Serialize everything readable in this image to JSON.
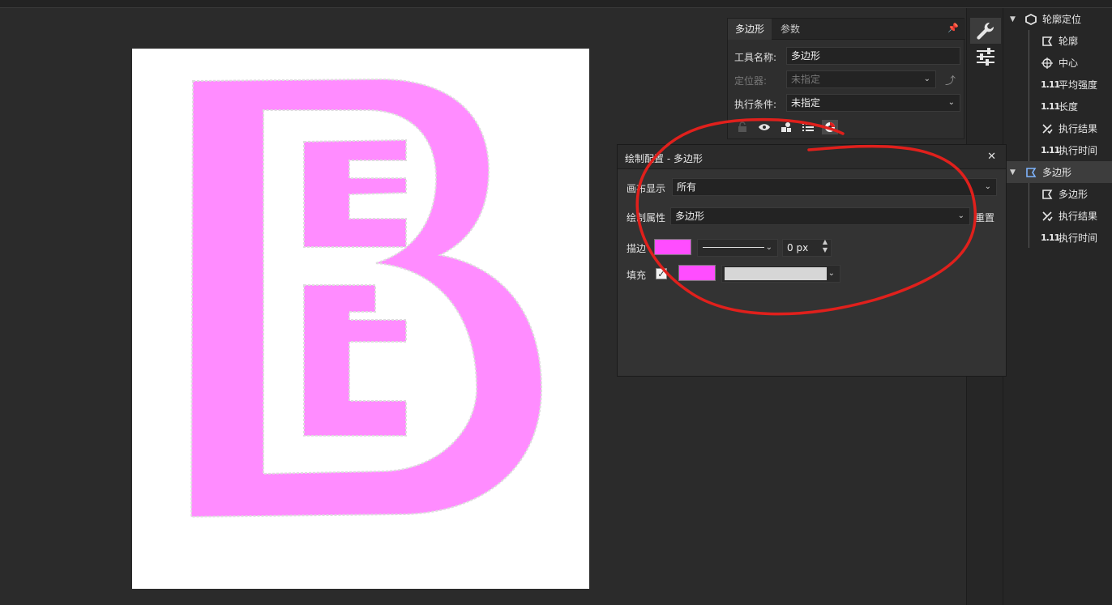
{
  "props_panel": {
    "tabs": [
      "多边形",
      "参数"
    ],
    "tool_name_label": "工具名称:",
    "tool_name_value": "多边形",
    "locator_label": "定位器:",
    "locator_value": "未指定",
    "condition_label": "执行条件:",
    "condition_value": "未指定"
  },
  "draw_dialog": {
    "title": "绘制配置 - 多边形",
    "canvas_display_label": "画布显示",
    "canvas_display_value": "所有",
    "draw_property_label": "绘制属性",
    "draw_property_value": "多边形",
    "reset_label": "重置",
    "stroke_label": "描边",
    "stroke_color": "#ff4dff",
    "stroke_width_value": "0 px",
    "fill_label": "填充",
    "fill_checked": true,
    "fill_color": "#ff4dff",
    "fill_pattern_color": "#d6d6d6"
  },
  "tree": {
    "items": [
      {
        "label": "轮廓定位",
        "icon": "hexagon-icon",
        "level": 0
      },
      {
        "label": "轮廓",
        "icon": "polygon-icon",
        "level": 1
      },
      {
        "label": "中心",
        "icon": "crosshair-icon",
        "level": 1
      },
      {
        "label": "平均强度",
        "icon": "number-icon",
        "num": "1.11",
        "level": 1
      },
      {
        "label": "长度",
        "icon": "number-icon",
        "num": "1.11",
        "level": 1
      },
      {
        "label": "执行结果",
        "icon": "result-icon",
        "level": 1
      },
      {
        "label": "执行时间",
        "icon": "number-icon",
        "num": "1.11",
        "level": 1
      },
      {
        "label": "多边形",
        "icon": "polygon-icon",
        "level": 0,
        "selected": true
      },
      {
        "label": "多边形",
        "icon": "polygon-icon",
        "level": 1
      },
      {
        "label": "执行结果",
        "icon": "result-icon",
        "level": 1
      },
      {
        "label": "执行时间",
        "icon": "number-icon",
        "num": "1.11",
        "level": 1
      }
    ]
  },
  "colors": {
    "accent_pink": "#ff8cff",
    "annotation_red": "#e0201c"
  }
}
